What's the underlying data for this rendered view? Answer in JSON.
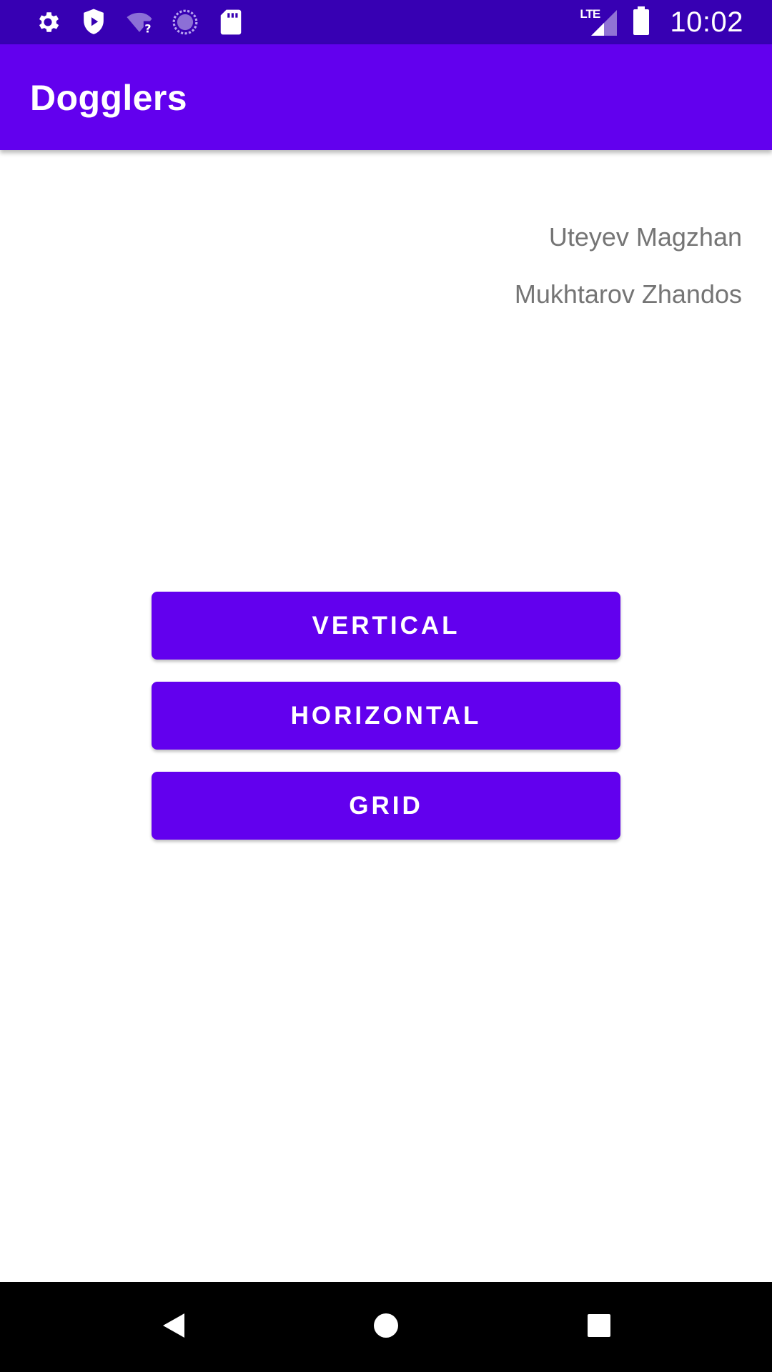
{
  "status_bar": {
    "time": "10:02",
    "network_label": "LTE",
    "left_icons": [
      "gear-icon",
      "shield-play-icon",
      "wifi-question-icon",
      "loading-circle-icon",
      "sd-card-icon"
    ],
    "right_icons": [
      "lte-signal-icon",
      "battery-icon"
    ]
  },
  "app_bar": {
    "title": "Dogglers",
    "color": "#6200ee"
  },
  "names": [
    "Uteyev Magzhan",
    "Mukhtarov Zhandos"
  ],
  "buttons": {
    "vertical": "VERTICAL",
    "horizontal": "HORIZONTAL",
    "grid": "GRID"
  },
  "nav_bar": {
    "icons": [
      "back-icon",
      "home-icon",
      "recents-icon"
    ]
  },
  "colors": {
    "status_bar": "#3700b3",
    "primary": "#6200ee",
    "name_text": "#757575"
  }
}
